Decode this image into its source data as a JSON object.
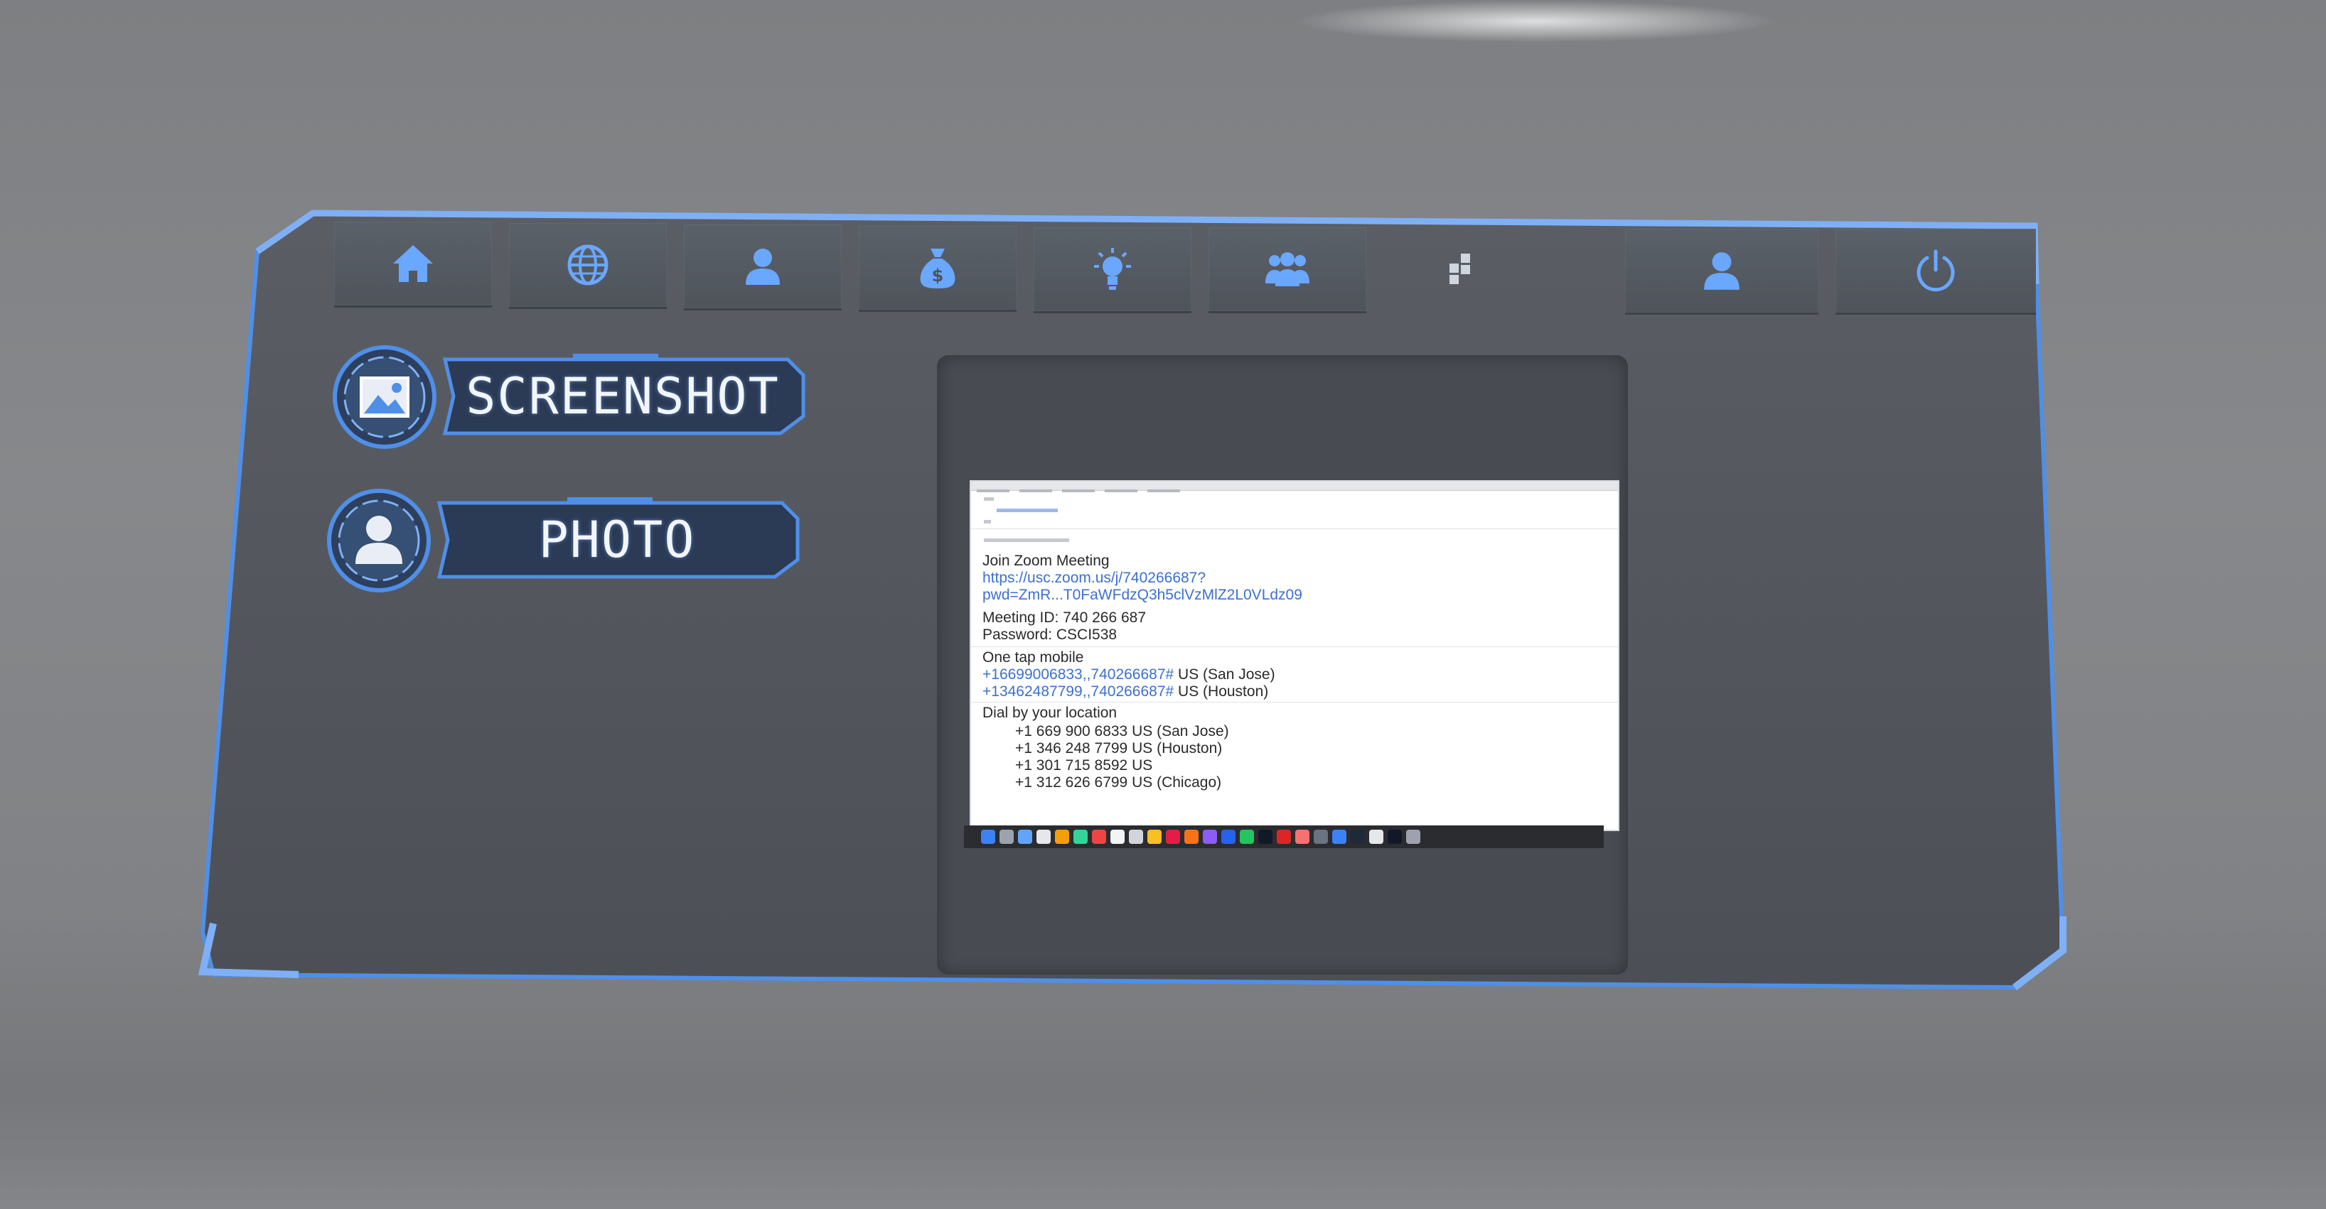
{
  "nav": {
    "items": [
      {
        "name": "home",
        "icon": "home-icon"
      },
      {
        "name": "globe",
        "icon": "globe-icon"
      },
      {
        "name": "profile",
        "icon": "user-icon"
      },
      {
        "name": "money",
        "icon": "money-bag-icon"
      },
      {
        "name": "ideas",
        "icon": "lightbulb-icon"
      },
      {
        "name": "group",
        "icon": "group-icon"
      },
      {
        "name": "apps",
        "icon": "grid-icon"
      },
      {
        "name": "account",
        "icon": "user-icon"
      },
      {
        "name": "power",
        "icon": "power-icon"
      }
    ]
  },
  "actions": {
    "screenshot": {
      "label": "SCREENSHOT",
      "icon": "image-icon"
    },
    "photo": {
      "label": "PHOTO",
      "icon": "person-icon"
    }
  },
  "preview": {
    "lines": {
      "heading": "Join Zoom Meeting",
      "link1": "https://usc.zoom.us/j/740266687?",
      "link2": "pwd=ZmR...T0FaWFdzQ3h5clVzMlZ2L0VLdz09",
      "meeting_id": "Meeting ID: 740 266 687",
      "password": "Password: CSCI538",
      "one_tap": "One tap mobile",
      "tap1_num": "+16699006833,,740266687#",
      "tap1_loc": " US (San Jose)",
      "tap2_num": "+13462487799,,740266687#",
      "tap2_loc": " US (Houston)",
      "dial": "Dial by your location",
      "d1": "+1 669 900 6833 US (San Jose)",
      "d2": "+1 346 248 7799 US (Houston)",
      "d3": "+1 301 715 8592 US",
      "d4": "+1 312 626 6799 US (Chicago)"
    }
  },
  "colors": {
    "accent": "#4f8fe8",
    "panel": "#54585e",
    "nav_button": "#575c63",
    "label_plate": "#2b3a55"
  }
}
